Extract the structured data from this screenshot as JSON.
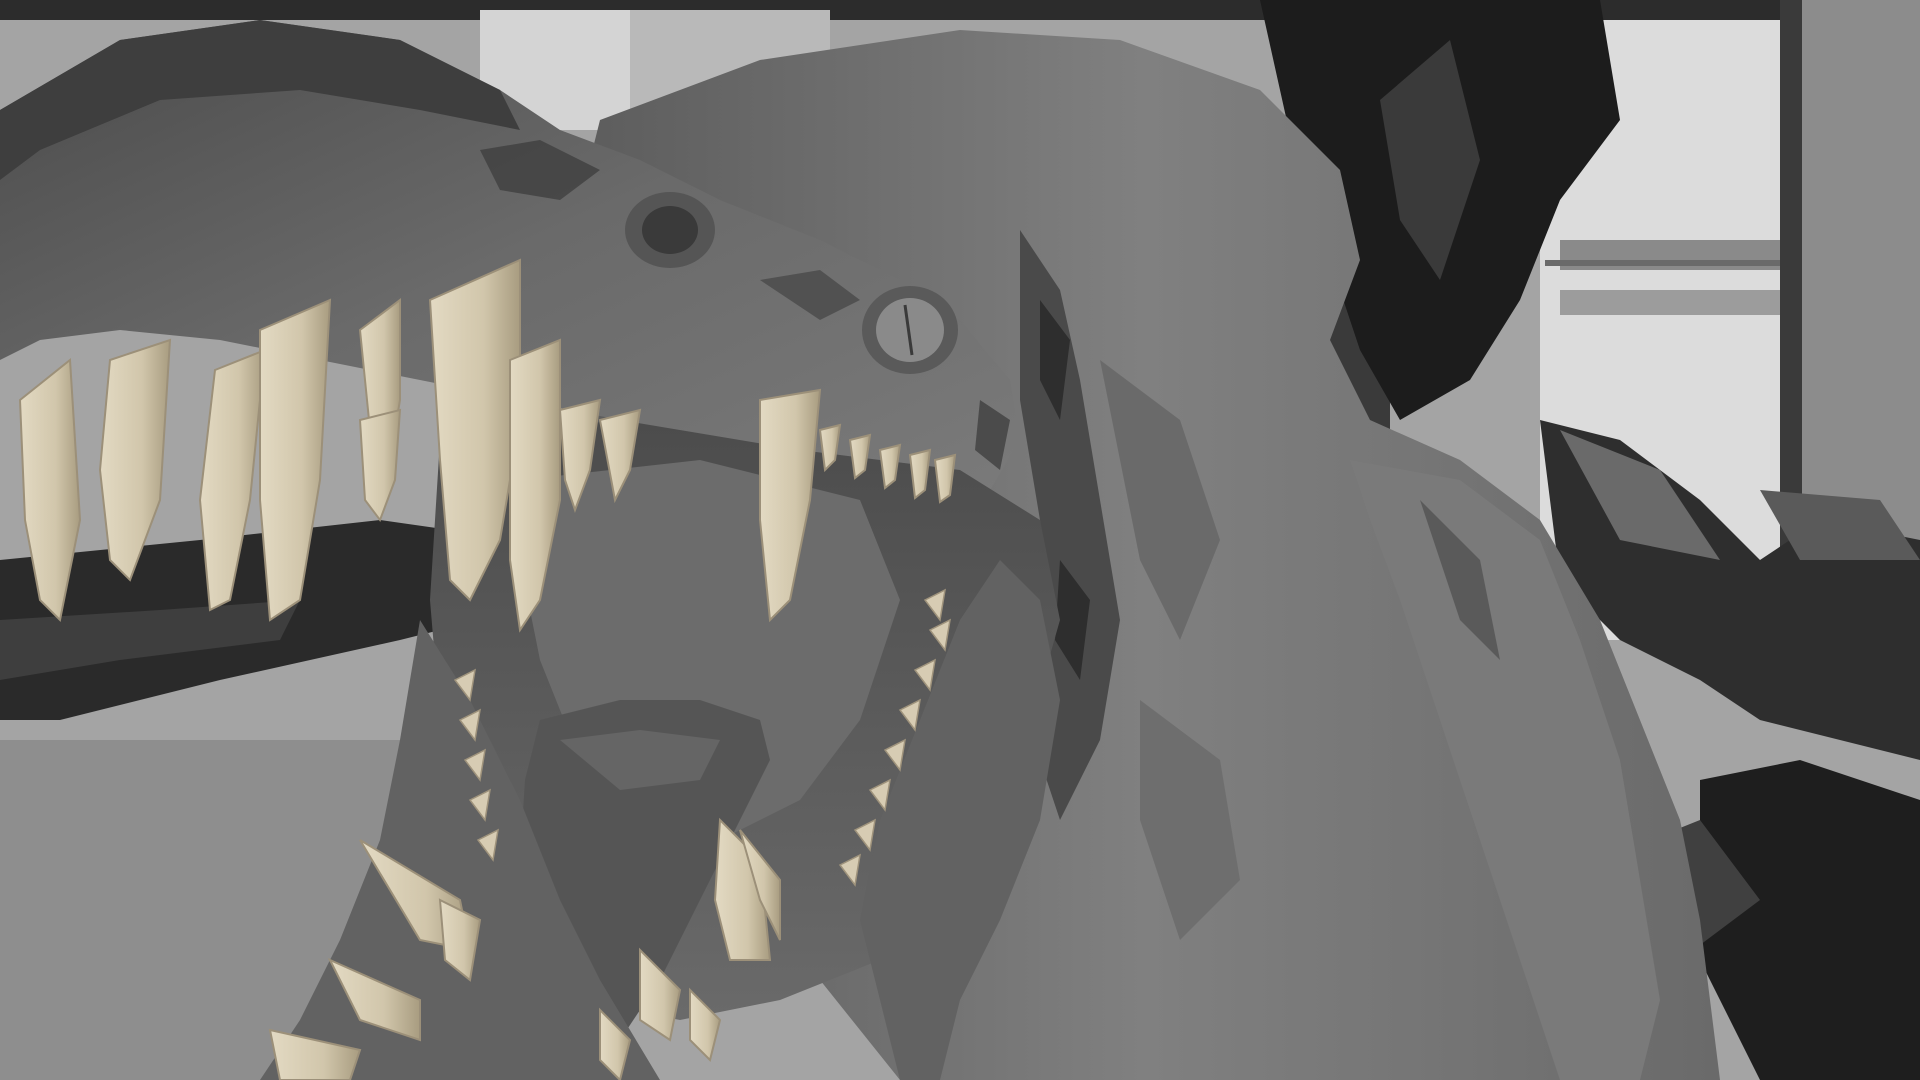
{
  "scene": {
    "subject": "creature-sculpt-render",
    "colors": {
      "background": "#9a9a9a",
      "wall_light": "#d6d6d6",
      "wall_mid": "#b4b4b4",
      "pillar": "#8a8a8a",
      "pillar_shadow": "#2a2a2a",
      "skin_dark": "#4b4b4b",
      "skin_mid": "#6e6e6e",
      "skin_light": "#8c8c8c",
      "mouth_inner": "#5a5a5a",
      "tongue": "#505050",
      "teeth": "#d3c9b0",
      "teeth_shadow": "#a99e86",
      "foliage_dark": "#1e1e1e",
      "foliage_mid": "#3c3c3c",
      "foliage_light": "#6a6a6a"
    },
    "icons": [
      "creature-head",
      "teeth",
      "tongue",
      "eye",
      "foliage",
      "pillar",
      "window-frame"
    ]
  }
}
